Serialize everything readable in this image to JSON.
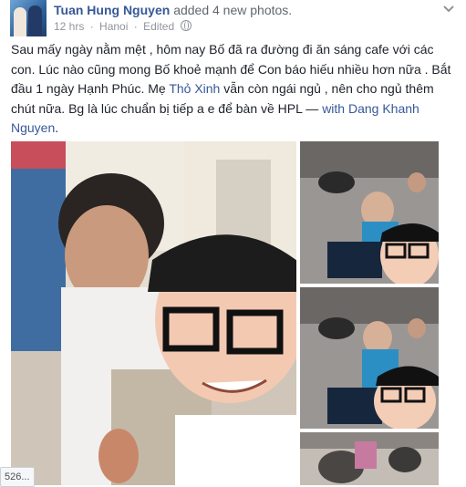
{
  "post": {
    "author": "Tuan Hung Nguyen",
    "action": "added 4 new photos.",
    "time": "12 hrs",
    "separator": "·",
    "location": "Hanoi",
    "edited": "Edited",
    "text_part1": "Sau mấy ngày nằm mệt , hôm nay Bố đã ra đường đi ăn sáng cafe với các con. Lúc nào cũng mong Bố khoẻ mạnh để Con báo hiếu nhiều hơn nữa . Bắt đầu 1 ngày Hạnh Phúc. Mẹ ",
    "tag1": "Thỏ Xinh",
    "text_part2": " vẫn còn ngái ngủ , nên cho ngủ thêm chút nữa. Bg là lúc chuẩn bị tiếp a e để bàn về HPL — ",
    "with_label": "with",
    "tag2": "Dang Khanh Nguyen",
    "text_end": "."
  },
  "overlay": {
    "chip_text": "526..."
  },
  "icons": {
    "privacy": "globe-icon",
    "options": "chevron-down-icon"
  },
  "colors": {
    "link": "#365899",
    "meta": "#90949c",
    "text": "#1d2129"
  }
}
